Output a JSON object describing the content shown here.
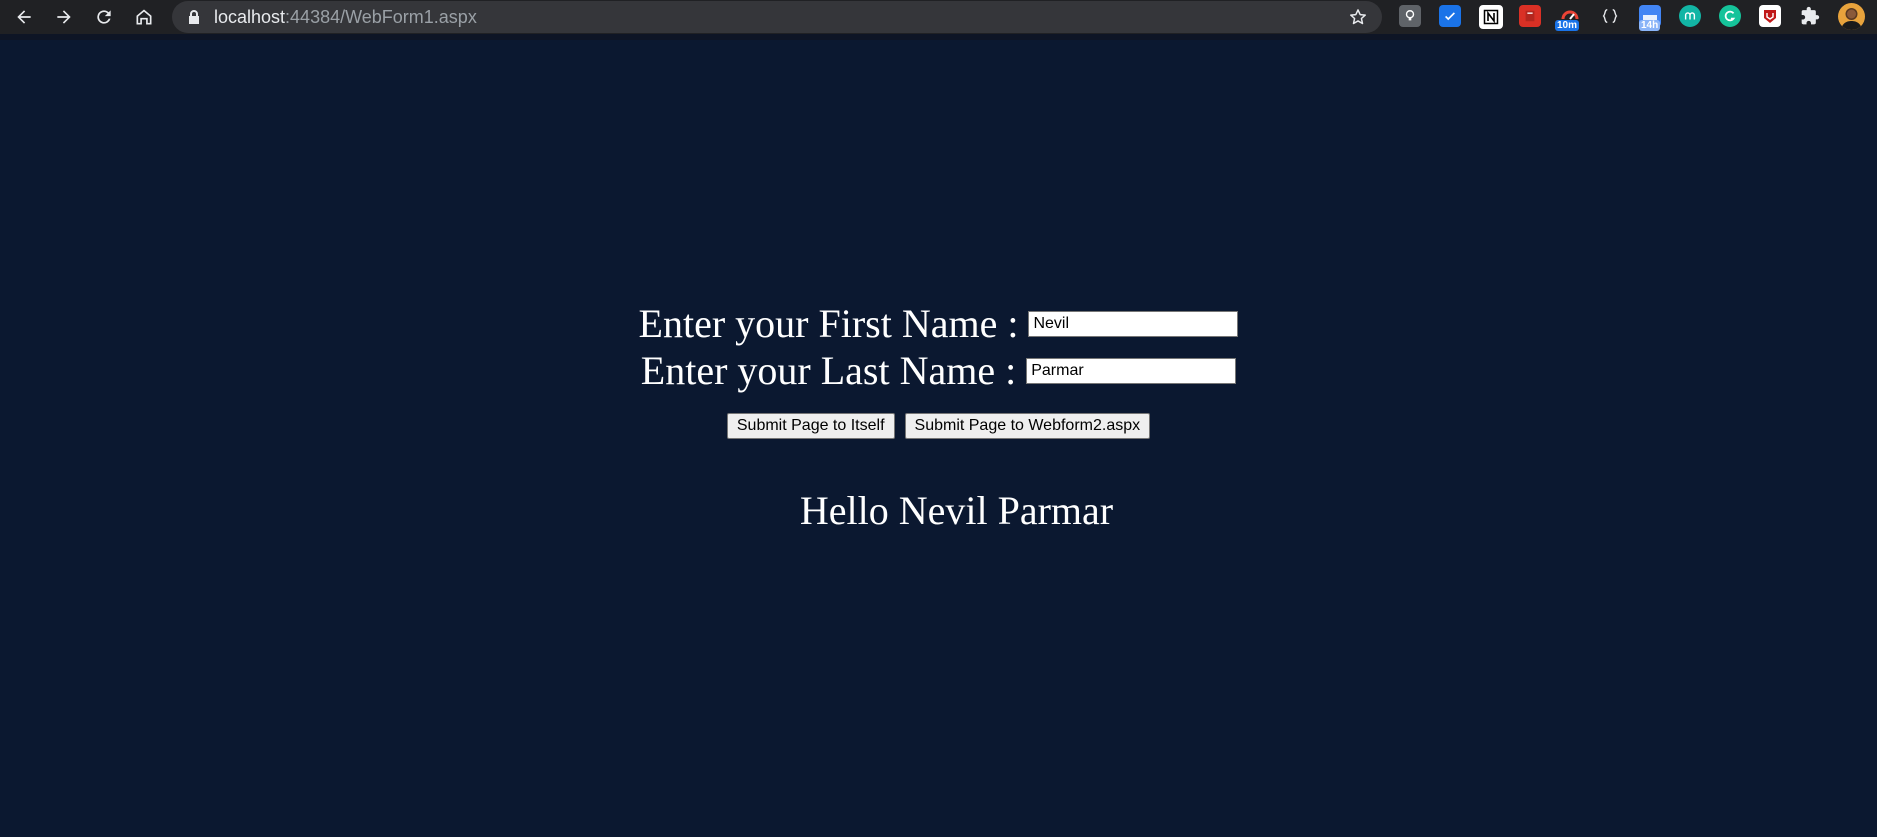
{
  "browser": {
    "url_host": "localhost",
    "url_path": ":44384/WebForm1.aspx",
    "icons": {
      "back": "back-arrow-icon",
      "forward": "forward-arrow-icon",
      "reload": "reload-icon",
      "home": "home-icon",
      "lock": "lock-icon",
      "star": "bookmark-star-icon"
    },
    "extensions": [
      {
        "name": "keep-ext-icon",
        "color": "#5f6368"
      },
      {
        "name": "todo-check-ext-icon",
        "color": "#1a73e8"
      },
      {
        "name": "notion-ext-icon",
        "color": "#ffffff"
      },
      {
        "name": "book-ext-icon",
        "color": "#d93025"
      },
      {
        "name": "timer-ext-icon",
        "color": "#1a73e8",
        "badge": "10m"
      },
      {
        "name": "json-ext-icon",
        "color": "#202124"
      },
      {
        "name": "calendar-ext-icon",
        "color": "#4285f4",
        "badge": "14h"
      },
      {
        "name": "mercury-ext-icon",
        "color": "#12b5a5"
      },
      {
        "name": "grammarly-ext-icon",
        "color": "#15c39a"
      },
      {
        "name": "mcafee-ext-icon",
        "color": "#c01818"
      },
      {
        "name": "puzzle-ext-icon",
        "color": "#e8eaed"
      },
      {
        "name": "profile-avatar",
        "color": "#e8a33c"
      }
    ]
  },
  "form": {
    "first_name_label": "Enter your First Name :",
    "first_name_value": "Nevil",
    "last_name_label": "Enter your Last Name :",
    "last_name_value": "Parmar",
    "submit_self_label": "Submit Page to Itself",
    "submit_other_label": "Submit Page to Webform2.aspx",
    "greeting": "Hello Nevil Parmar"
  },
  "colors": {
    "page_background": "#0b1830",
    "text": "#ffffff",
    "toolbar": "#202124"
  }
}
